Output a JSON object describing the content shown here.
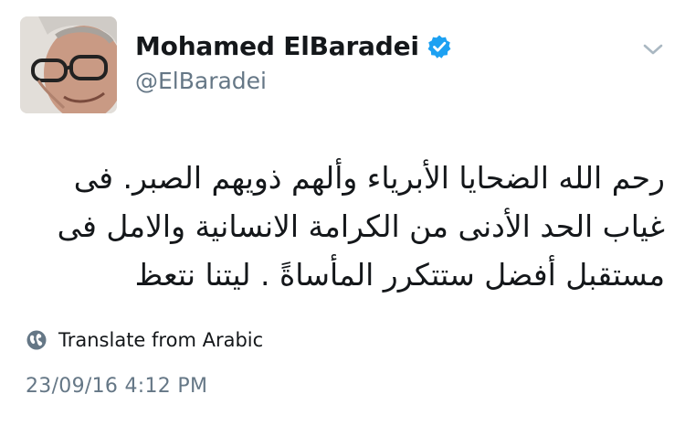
{
  "author": {
    "display_name": "Mohamed ElBaradei",
    "handle": "@ElBaradei",
    "verified": true,
    "avatar_icon": "profile-photo",
    "verified_icon": "verified-badge-icon",
    "verified_color": "#1da1f2"
  },
  "menu": {
    "icon": "chevron-down-icon"
  },
  "tweet": {
    "lines": [
      "رحم الله الضحايا الأبرياء وألهم ذويهم الصبر. فى",
      "غياب الحد الأدنى من الكرامة الانسانية والامل فى",
      "مستقبل أفضل ستتكرر المأساةً . ليتنا نتعظ"
    ]
  },
  "translate": {
    "icon": "globe-icon",
    "label": "Translate from Arabic"
  },
  "timestamp": "23/09/16 4:12 PM"
}
